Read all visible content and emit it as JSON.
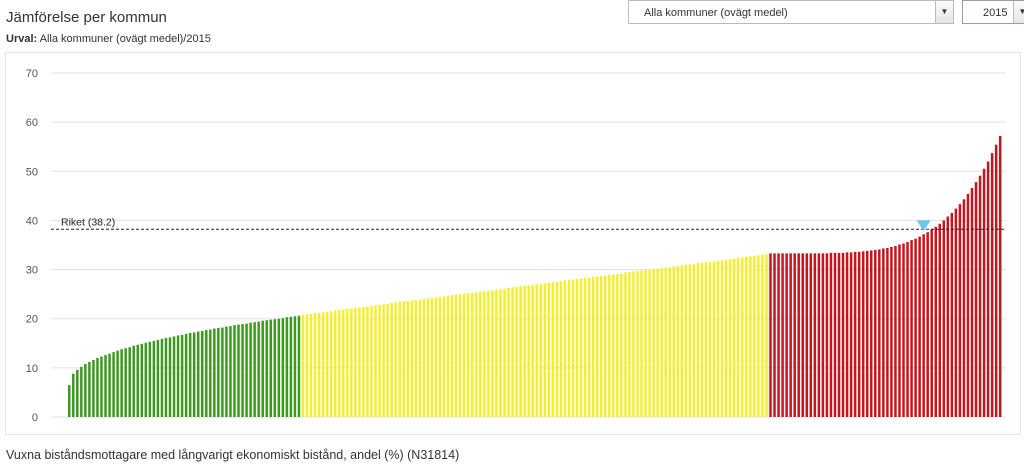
{
  "header": {
    "title": "Jämförelse per kommun",
    "subtitle_label": "Urval:",
    "subtitle_value": " Alla kommuner (ovägt medel)/2015"
  },
  "controls": {
    "kommun_select": "Alla kommuner (ovägt medel)",
    "year_select": "2015"
  },
  "footer": {
    "caption": "Vuxna biståndsmottagare med långvarigt ekonomiskt bistånd, andel (%) (N31814)"
  },
  "colors": {
    "green": "#3c9a1e",
    "yellow": "#f4ef2c",
    "red": "#c8141e",
    "marker": "#6ec6f0"
  },
  "chart_data": {
    "type": "bar",
    "title": "",
    "xlabel": "",
    "ylabel": "",
    "ylim": [
      0,
      70
    ],
    "yticks": [
      0,
      10,
      20,
      30,
      40,
      50,
      60,
      70
    ],
    "grid": true,
    "reference": {
      "label": "Riket (38.2)",
      "value": 38.2
    },
    "groups": [
      {
        "name": "green",
        "count": 58,
        "start": 6.5,
        "end": 20.6
      },
      {
        "name": "yellow",
        "count": 116,
        "start": 20.8,
        "end": 33.1
      },
      {
        "name": "red",
        "count": 58,
        "start": 33.3,
        "end": 57.2
      }
    ],
    "highlighted_bar_value": 37.4
  }
}
